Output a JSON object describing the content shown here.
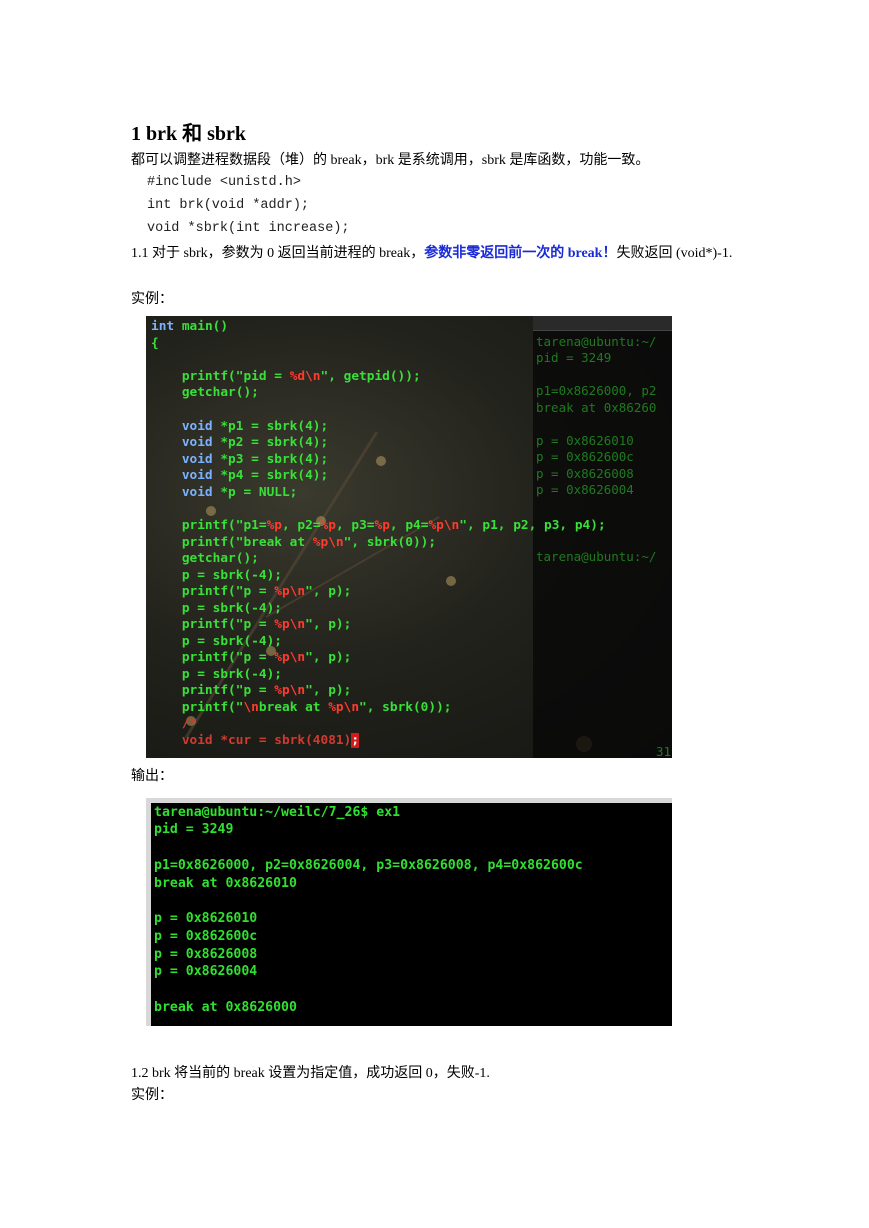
{
  "heading": "1 brk 和 sbrk",
  "intro": "都可以调整进程数据段（堆）的 break，brk 是系统调用，sbrk 是库函数，功能一致。",
  "code_lines": [
    "#include <unistd.h>",
    "int brk(void *addr);",
    "void *sbrk(int increase);"
  ],
  "s11": {
    "prefix": "1.1 对于 sbrk，参数为 0 返回当前进程的 break，",
    "highlight": "参数非零返回前一次的 break！",
    "suffix": "失败返回 (void*)-1."
  },
  "example_label": "实例：",
  "output_label": "输出：",
  "s12": "1.2 brk 将当前的 break 设置为指定值，成功返回 0，失败-1.",
  "example_label2": "实例：",
  "editor": {
    "l1a": "int",
    "l1b": " main()",
    "l2": "{",
    "l3a": "    printf(\"pid = ",
    "l3f": "%d\\n",
    "l3b": "\", getpid());",
    "l4": "    getchar();",
    "v1a": "    void",
    "v1b": " *p1 = sbrk(4);",
    "v2a": "    void",
    "v2b": " *p2 = sbrk(4);",
    "v3a": "    void",
    "v3b": " *p3 = sbrk(4);",
    "v4a": "    void",
    "v4b": " *p4 = sbrk(4);",
    "v5a": "    void",
    "v5b": " *p = NULL;",
    "pr1a": "    printf(\"p1=",
    "pr1f1": "%p",
    "pr1b": ", p2=",
    "pr1f2": "%p",
    "pr1c": ", p3=",
    "pr1f3": "%p",
    "pr1d": ", p4=",
    "pr1f4": "%p\\n",
    "pr1e": "\", p1, p2, p3, p4);",
    "pr2a": "    printf(\"break at ",
    "pr2f": "%p\\n",
    "pr2b": "\", sbrk(0));",
    "gc": "    getchar();",
    "sb": "    p = sbrk(-4);",
    "pp_a": "    printf(\"p = ",
    "pp_f": "%p\\n",
    "pp_b": "\", p);",
    "fin_a": "    printf(\"",
    "fin_f": "\\n",
    "fin_b": "break at ",
    "fin_f2": "%p\\n",
    "fin_c": "\", sbrk(0));",
    "cm1": "    /*",
    "last_a": "    void *cur = sbrk(4081)",
    "last_cur": ";"
  },
  "term_right": {
    "l1": "tarena@ubuntu:~/",
    "l2": "pid = 3249",
    "l3": "p1=0x8626000, p2",
    "l4": "break at 0x86260",
    "l5": "p = 0x8626010",
    "l6": "p = 0x862600c",
    "l7": "p = 0x8626008",
    "l8": "p = 0x8626004",
    "l9": "tarena@ubuntu:~/",
    "l10": "31"
  },
  "output": {
    "prompt": "tarena@ubuntu:~/weilc/7_26$ ex1",
    "pid": "pid = 3249",
    "pointers": "p1=0x8626000, p2=0x8626004, p3=0x8626008, p4=0x862600c",
    "break1": "break at 0x8626010",
    "p1": "p = 0x8626010",
    "p2": "p = 0x862600c",
    "p3": "p = 0x8626008",
    "p4": "p = 0x8626004",
    "break2": "break at 0x8626000"
  }
}
